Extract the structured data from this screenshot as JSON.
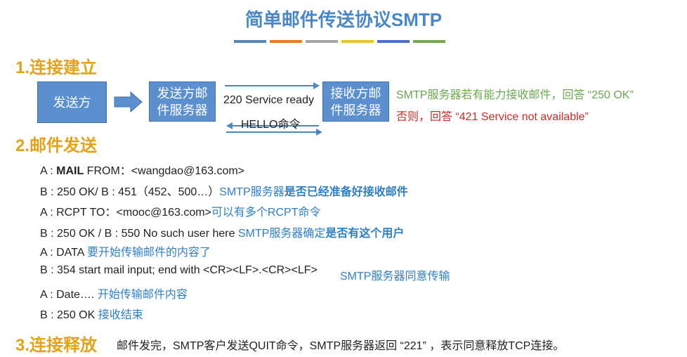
{
  "title": "简单邮件传送协议SMTP",
  "title_bar_colors": [
    "#4f86c6",
    "#e57b2e",
    "#a5a5a5",
    "#f2c02f",
    "#4472c4",
    "#70ad47"
  ],
  "sections": {
    "s1": "1.连接建立",
    "s2": "2.邮件发送",
    "s3": "3.连接释放"
  },
  "diagram": {
    "sender": "发送方",
    "sender_server": "发送方邮件服务器",
    "receiver_server": "接收方邮件服务器",
    "msg_top": "220 Service ready",
    "msg_bottom": "HELLO命令",
    "response_ok": "SMTP服务器若有能力接收邮件，回答 “250 OK”",
    "response_fail": "否则，回答 “421 Service not available”"
  },
  "mail_send": [
    {
      "pre": "A : ",
      "bold": "MAIL",
      "text": " FROM：<wangdao@163.com>",
      "note_plain": "",
      "note_bold": ""
    },
    {
      "pre": "B : ",
      "bold": "",
      "text": "250 OK/ B : 451（452、500…）",
      "note_plain": "SMTP服务器",
      "note_bold": "是否已经准备好接收邮件"
    },
    {
      "pre": "A : ",
      "bold": "",
      "text": "RCPT TO：<mooc@163.com>",
      "note_plain": "可以有多个RCPT命令",
      "note_bold": ""
    },
    {
      "pre": "B : ",
      "bold": "",
      "text": "250 OK / B : 550 No such user here ",
      "note_plain": "SMTP服务器确定",
      "note_bold": "是否有这个用户"
    },
    {
      "pre": "A : ",
      "bold": "",
      "text": "DATA ",
      "note_plain": "要开始传输邮件的内容了",
      "note_bold": ""
    },
    {
      "pre": "B : ",
      "bold": "",
      "text": "354 start mail input; end with <CR><LF>.<CR><LF>",
      "note_plain": "SMTP服务器同意传输",
      "note_bold": ""
    },
    {
      "pre": "A : ",
      "bold": "",
      "text": "Date….  ",
      "note_plain": "开始传输邮件内容",
      "note_bold": ""
    },
    {
      "pre": "B : ",
      "bold": "",
      "text": "250 OK  ",
      "note_plain": "接收结束",
      "note_bold": ""
    }
  ],
  "release_text": "邮件发完，SMTP客户发送QUIT命令，SMTP服务器返回 “221” ，表示同意释放TCP连接。"
}
